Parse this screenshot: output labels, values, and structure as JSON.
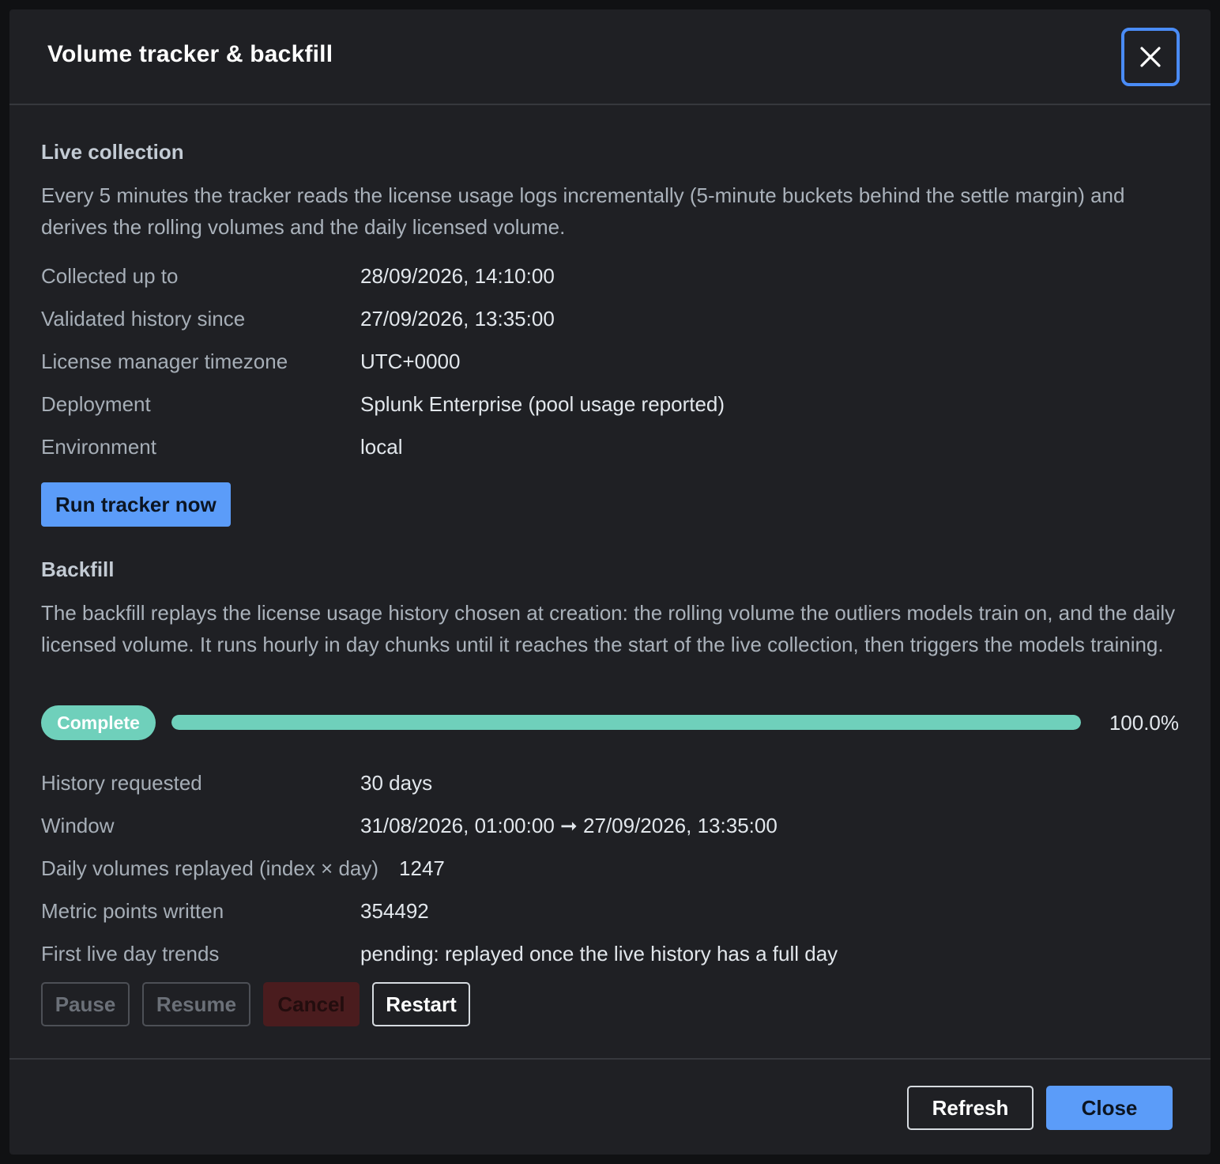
{
  "dialog": {
    "title": "Volume tracker & backfill",
    "close_icon": "close-icon"
  },
  "live": {
    "heading": "Live collection",
    "description": "Every 5 minutes the tracker reads the license usage logs incrementally (5-minute buckets behind the settle margin) and derives the rolling volumes and the daily licensed volume.",
    "rows": [
      {
        "label": "Collected up to",
        "value": "28/09/2026, 14:10:00"
      },
      {
        "label": "Validated history since",
        "value": "27/09/2026, 13:35:00"
      },
      {
        "label": "License manager timezone",
        "value": "UTC+0000"
      },
      {
        "label": "Deployment",
        "value": "Splunk Enterprise (pool usage reported)"
      },
      {
        "label": "Environment",
        "value": "local"
      }
    ],
    "run_button": "Run tracker now"
  },
  "backfill": {
    "heading": "Backfill",
    "description": "The backfill replays the license usage history chosen at creation: the rolling volume the outliers models train on, and the daily licensed volume. It runs hourly in day chunks until it reaches the start of the live collection, then triggers the models training.",
    "status_badge": "Complete",
    "progress_percent": 100.0,
    "progress_label": "100.0%",
    "rows": [
      {
        "label": "History requested",
        "value": "30 days"
      },
      {
        "label": "Window",
        "value": "31/08/2026, 01:00:00 ➞ 27/09/2026, 13:35:00"
      },
      {
        "label": "Daily volumes replayed (index × day)",
        "value": "1247"
      },
      {
        "label": "Metric points written",
        "value": "354492"
      },
      {
        "label": "First live day trends",
        "value": "pending: replayed once the live history has a full day"
      }
    ],
    "buttons": {
      "pause": "Pause",
      "resume": "Resume",
      "cancel": "Cancel",
      "restart": "Restart"
    }
  },
  "footer": {
    "refresh": "Refresh",
    "close": "Close"
  },
  "colors": {
    "accent": "#5b9cf9",
    "success": "#6fd0bb",
    "danger": "#4a1c1e",
    "background": "#1f2024"
  }
}
